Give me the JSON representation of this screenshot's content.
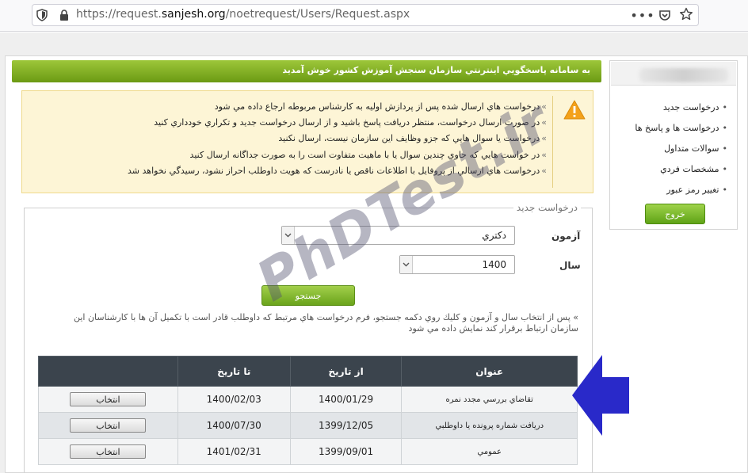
{
  "browser": {
    "url_prefix": "https://request.",
    "url_host": "sanjesh.org",
    "url_path": "/noetrequest/Users/Request.aspx"
  },
  "header": {
    "welcome": "به سامانه پاسخگويي اينترنتي سازمان سنجش آموزش كشور خوش آمديد"
  },
  "warnings": [
    "درخواست هاي ارسال شده پس از پردازش اوليه به كارشناس مربوطه ارجاع داده مي شود",
    "در صورت ارسال درخواست، منتظر دريافت پاسخ باشيد و از ارسال درخواست جديد و تكراري خودداري كنيد",
    "درخواست يا سوال هايي كه جزو وظايف اين سازمان نيست، ارسال نكنيد",
    "در خواست هايي كه حاوي چندين سوال يا با ماهيت متفاوت است را به صورت جداگانه ارسال كنيد",
    "درخواست هاي ارسالي از پروفايل با اطلاعات ناقص يا نادرست كه هويت داوطلب احراز نشود، رسيدگي نخواهد شد"
  ],
  "form": {
    "legend": "درخواست جديد",
    "exam_label": "آزمون",
    "exam_value": "دكتري",
    "year_label": "سال",
    "year_value": "1400",
    "search_label": "جستجو",
    "hint": "پس از انتخاب سال و آزمون و كليك روي دكمه جستجو، فرم درخواست هاي مرتبط كه داوطلب قادر است با تكميل آن ها با كارشناسان اين سازمان ارتباط برقرار كند نمايش داده مي شود"
  },
  "table": {
    "headers": [
      "عنوان",
      "از تاريخ",
      "تا تاريخ",
      ""
    ],
    "select_label": "انتخاب",
    "rows": [
      {
        "title": "تقاضاي بررسي مجدد نمره",
        "from": "1400/01/29",
        "to": "1400/02/03"
      },
      {
        "title": "دريافت شماره پرونده يا داوطلبي",
        "from": "1399/12/05",
        "to": "1400/07/30"
      },
      {
        "title": "عمومي",
        "from": "1399/09/01",
        "to": "1401/02/31"
      }
    ]
  },
  "sidebar": {
    "items": [
      "درخواست جديد",
      "درخواست ها و پاسخ ها",
      "سوالات متداول",
      "مشخصات فردي",
      "تغيير رمز عبور"
    ],
    "logout_label": "خروج"
  },
  "watermark": "PhDTest.ir",
  "colors": {
    "header_green": "#7fae22",
    "warning_bg": "#fdf5d6",
    "table_header": "#3b444d",
    "arrow_blue": "#2929c9"
  }
}
